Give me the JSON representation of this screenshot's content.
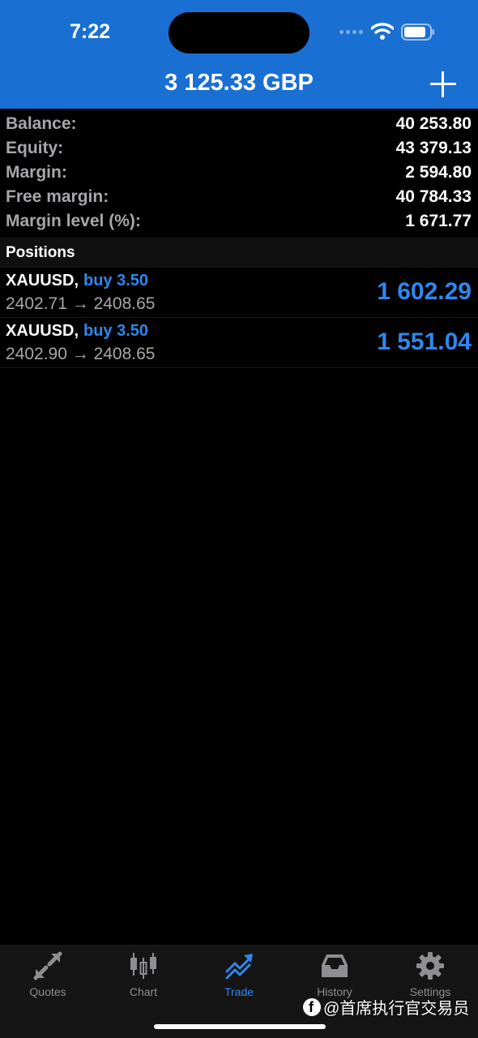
{
  "status_bar": {
    "time": "7:22"
  },
  "header": {
    "title": "3 125.33 GBP",
    "add_icon": "plus-icon"
  },
  "account": [
    {
      "label": "Balance:",
      "value": "40 253.80"
    },
    {
      "label": "Equity:",
      "value": "43 379.13"
    },
    {
      "label": "Margin:",
      "value": "2 594.80"
    },
    {
      "label": "Free margin:",
      "value": "40 784.33"
    },
    {
      "label": "Margin level (%):",
      "value": "1 671.77"
    }
  ],
  "positions": {
    "title": "Positions",
    "items": [
      {
        "symbol": "XAUUSD,",
        "side": "buy 3.50",
        "prices": "2402.71 → 2408.65",
        "profit": "1 602.29"
      },
      {
        "symbol": "XAUUSD,",
        "side": "buy 3.50",
        "prices": "2402.90 → 2408.65",
        "profit": "1 551.04"
      }
    ]
  },
  "tabs": [
    {
      "label": "Quotes",
      "icon": "quotes-icon",
      "active": false
    },
    {
      "label": "Chart",
      "icon": "candlestick-icon",
      "active": false
    },
    {
      "label": "Trade",
      "icon": "trend-icon",
      "active": true
    },
    {
      "label": "History",
      "icon": "inbox-icon",
      "active": false
    },
    {
      "label": "Settings",
      "icon": "gear-icon",
      "active": false
    }
  ],
  "watermark": {
    "text": "@首席执行官交易员"
  },
  "colors": {
    "header_bg": "#1a6fd3",
    "accent": "#2f87ee",
    "background": "#000000",
    "tabbar_bg": "#151515",
    "label_gray": "#a6a6ab"
  }
}
